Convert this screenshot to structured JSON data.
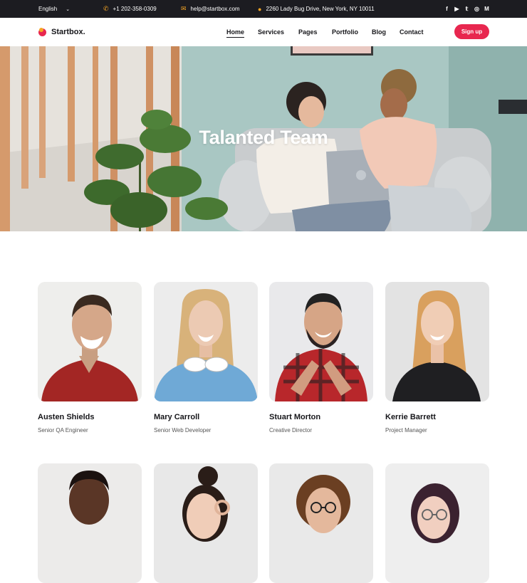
{
  "topbar": {
    "language": "English",
    "phone": "+1 202-358-0309",
    "email": "help@startbox.com",
    "address": "2260 Lady Bug Drive, New York, NY 10011",
    "social_icons": [
      "facebook-icon",
      "youtube-icon",
      "twitter-icon",
      "instagram-icon",
      "medium-icon"
    ]
  },
  "nav": {
    "brand": "Startbox.",
    "items": [
      "Home",
      "Services",
      "Pages",
      "Portfolio",
      "Blog",
      "Contact"
    ],
    "active": "Home",
    "signup_label": "Sign up"
  },
  "hero": {
    "title": "Talanted Team"
  },
  "team": [
    {
      "name": "Austen Shields",
      "role": "Senior QA Engineer"
    },
    {
      "name": "Mary Carroll",
      "role": "Senior Web Developer"
    },
    {
      "name": "Stuart Morton",
      "role": "Creative Director"
    },
    {
      "name": "Kerrie Barrett",
      "role": "Project Manager"
    },
    {
      "name": "",
      "role": ""
    },
    {
      "name": "",
      "role": ""
    },
    {
      "name": "",
      "role": ""
    },
    {
      "name": "",
      "role": ""
    }
  ],
  "colors": {
    "accent": "#e8274f",
    "topbar_bg": "#1c1c21",
    "icon_orange": "#f5a524"
  }
}
